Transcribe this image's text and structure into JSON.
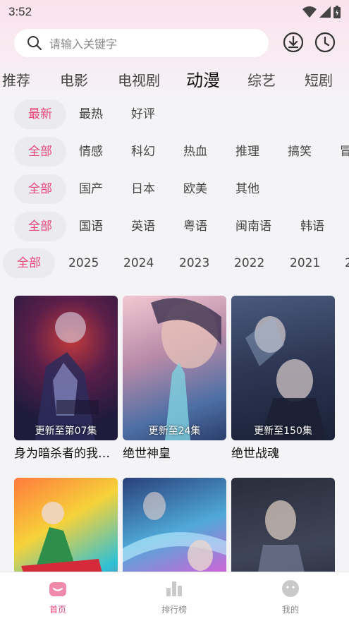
{
  "status": {
    "time": "3:52"
  },
  "search": {
    "placeholder": "请输入关键字"
  },
  "nav_tabs": [
    "推荐",
    "电影",
    "电视剧",
    "动漫",
    "综艺",
    "短剧"
  ],
  "active_tab": "动漫",
  "filters": {
    "sort": [
      "最新",
      "最热",
      "好评"
    ],
    "genre": [
      "全部",
      "情感",
      "科幻",
      "热血",
      "推理",
      "搞笑",
      "冒"
    ],
    "region": [
      "全部",
      "国产",
      "日本",
      "欧美",
      "其他"
    ],
    "language": [
      "全部",
      "国语",
      "英语",
      "粤语",
      "闽南语",
      "韩语"
    ],
    "year": [
      "全部",
      "2025",
      "2024",
      "2023",
      "2022",
      "2021",
      "2"
    ]
  },
  "cards": [
    {
      "title": "身为暗杀者的我…",
      "episode": "更新至第07集"
    },
    {
      "title": "绝世神皇",
      "episode": "更新至24集"
    },
    {
      "title": "绝世战魂",
      "episode": "更新至150集"
    },
    {
      "title": "",
      "episode": ""
    },
    {
      "title": "",
      "episode": ""
    },
    {
      "title": "",
      "episode": ""
    }
  ],
  "bottom_nav": [
    {
      "label": "首页",
      "icon": "home-icon"
    },
    {
      "label": "排行榜",
      "icon": "ranking-icon"
    },
    {
      "label": "我的",
      "icon": "profile-icon"
    }
  ],
  "colors": {
    "accent": "#e8467c",
    "chip_bg": "#ebebee",
    "background": "#f4f4f6"
  }
}
